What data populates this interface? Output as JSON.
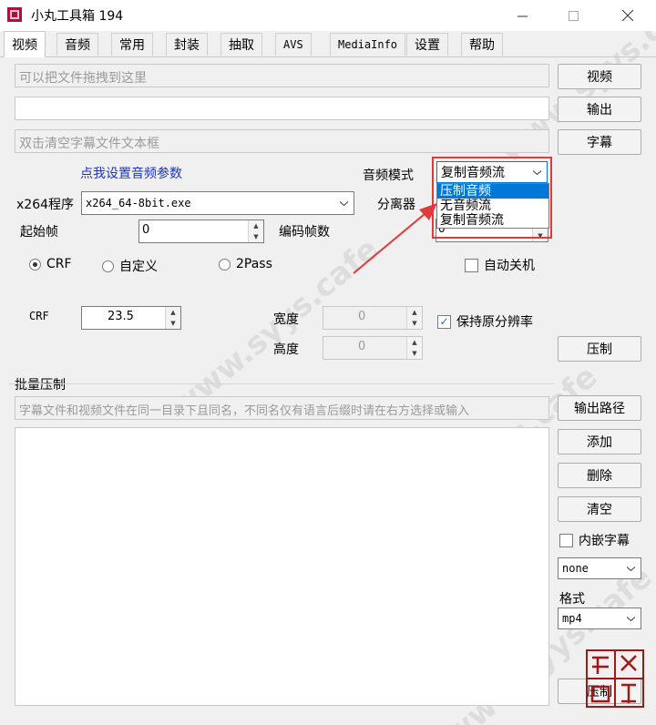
{
  "window": {
    "title": "小丸工具箱 194"
  },
  "tabs": [
    "视频",
    "音频",
    "常用",
    "封装",
    "抽取",
    "AVS",
    "MediaInfo",
    "设置",
    "帮助"
  ],
  "inputs": {
    "video_drop_placeholder": "可以把文件拖拽到这里",
    "output_value": "",
    "subtitle_placeholder": "双击清空字幕文件文本框"
  },
  "buttons": {
    "video": "视频",
    "output": "输出",
    "subtitle": "字幕",
    "encode": "压制",
    "output_path": "输出路径",
    "add": "添加",
    "delete": "删除",
    "clear": "清空",
    "batch_encode": "压制"
  },
  "audio_params_link": "点我设置音频参数",
  "x264": {
    "label": "x264程序",
    "value": "x264_64-8bit.exe"
  },
  "audio_mode": {
    "label": "音频模式",
    "value": "复制音频流",
    "options": [
      "压制音频",
      "无音频流",
      "复制音频流"
    ],
    "selected_index": 0
  },
  "demuxer": {
    "label": "分离器",
    "value": "0"
  },
  "start_frame": {
    "label": "起始帧",
    "value": "0"
  },
  "encode_frames": {
    "label": "编码帧数"
  },
  "rate_modes": [
    {
      "label": "CRF",
      "checked": true
    },
    {
      "label": "自定义",
      "checked": false
    },
    {
      "label": "2Pass",
      "checked": false
    }
  ],
  "auto_shutdown": {
    "label": "自动关机",
    "checked": false
  },
  "crf": {
    "label": "CRF",
    "value": "23.5"
  },
  "width": {
    "label": "宽度",
    "value": "0"
  },
  "height": {
    "label": "高度",
    "value": "0"
  },
  "keep_resolution": {
    "label": "保持原分辨率",
    "checked": true
  },
  "batch": {
    "title": "批量压制",
    "hint": "字幕文件和视频文件在同一目录下且同名，不同名仅有语言后缀时请在右方选择或输入"
  },
  "embed_subtitle": {
    "label": "内嵌字幕",
    "checked": false
  },
  "subtitle_lang": {
    "value": "none"
  },
  "format": {
    "label": "格式",
    "value": "mp4"
  },
  "watermark_text": "www.syys.cafe",
  "colors": {
    "accent": "#0078d7",
    "highlight_border": "#e03a3a",
    "arrow": "#e03a3a",
    "link": "#1a33cc",
    "stamp": "#a01818"
  }
}
